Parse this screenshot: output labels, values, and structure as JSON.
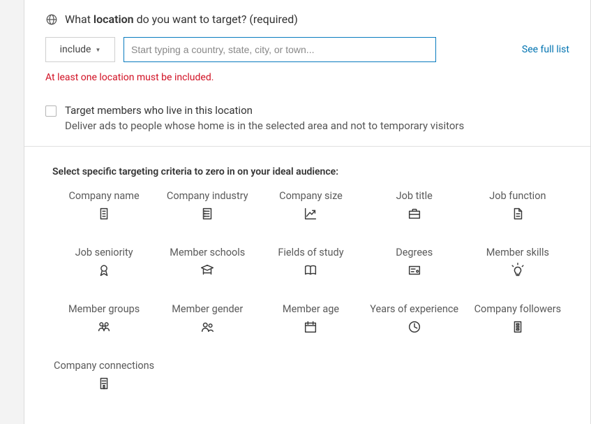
{
  "location": {
    "question_prefix": "What ",
    "question_bold": "location",
    "question_suffix": " do you want to target? (required)",
    "include_label": "include",
    "input_placeholder": "Start typing a country, state, city, or town...",
    "input_value": "",
    "see_full_list": "See full list",
    "error": "At least one location must be included.",
    "checkbox": {
      "checked": false,
      "title": "Target members who live in this location",
      "sub": "Deliver ads to people whose home is in the selected area and not to temporary visitors"
    }
  },
  "criteria": {
    "heading": "Select specific targeting criteria to zero in on your ideal audience:",
    "items": [
      {
        "label": "Company name",
        "icon": "building"
      },
      {
        "label": "Company industry",
        "icon": "list-doc"
      },
      {
        "label": "Company size",
        "icon": "chart"
      },
      {
        "label": "Job title",
        "icon": "briefcase"
      },
      {
        "label": "Job function",
        "icon": "document"
      },
      {
        "label": "Job seniority",
        "icon": "medal"
      },
      {
        "label": "Member schools",
        "icon": "school"
      },
      {
        "label": "Fields of study",
        "icon": "book"
      },
      {
        "label": "Degrees",
        "icon": "certificate"
      },
      {
        "label": "Member skills",
        "icon": "bulb"
      },
      {
        "label": "Member groups",
        "icon": "group"
      },
      {
        "label": "Member gender",
        "icon": "people"
      },
      {
        "label": "Member age",
        "icon": "calendar"
      },
      {
        "label": "Years of experience",
        "icon": "clock"
      },
      {
        "label": "Company followers",
        "icon": "building2"
      },
      {
        "label": "Company connections",
        "icon": "building3"
      }
    ]
  }
}
